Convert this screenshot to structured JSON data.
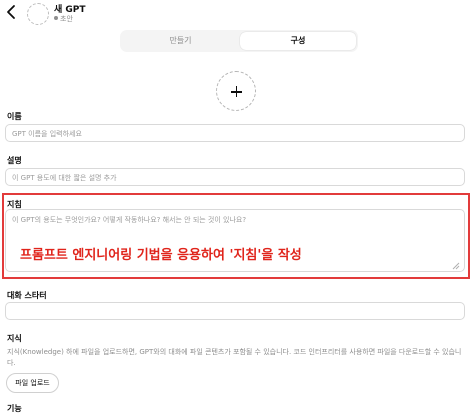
{
  "header": {
    "title": "새 GPT",
    "status": "초안"
  },
  "tabs": [
    {
      "label": "만들기"
    },
    {
      "label": "구성"
    }
  ],
  "fields": {
    "name": {
      "label": "이름",
      "placeholder": "GPT 이름을 입력하세요"
    },
    "description": {
      "label": "설명",
      "placeholder": "이 GPT 용도에 대한 짧은 설명 추가"
    },
    "instructions": {
      "label": "지침",
      "placeholder": "이 GPT의 용도는 무엇인가요? 어떻게 작동하나요? 해서는 안 되는 것이 있나요?"
    },
    "starters": {
      "label": "대화 스타터"
    }
  },
  "annotation": {
    "text": "프롬프트 엔지니어링 기법을 응용하여 '지침'을 작성",
    "color": "#e0241b"
  },
  "knowledge": {
    "label": "지식",
    "description": "지식(Knowledge) 하에 파일을 업로드하면, GPT와의 대화에 파일 콘텐츠가 포함될 수 있습니다. 코드 인터프리터를 사용하면 파일을 다운로드할 수 있습니다.",
    "upload_label": "파일 업로드"
  },
  "capabilities": {
    "label": "기능"
  },
  "colors": {
    "highlight_border": "#e23b3b",
    "accent_text": "#e0241b",
    "tab_bg": "#f4f4f4"
  }
}
